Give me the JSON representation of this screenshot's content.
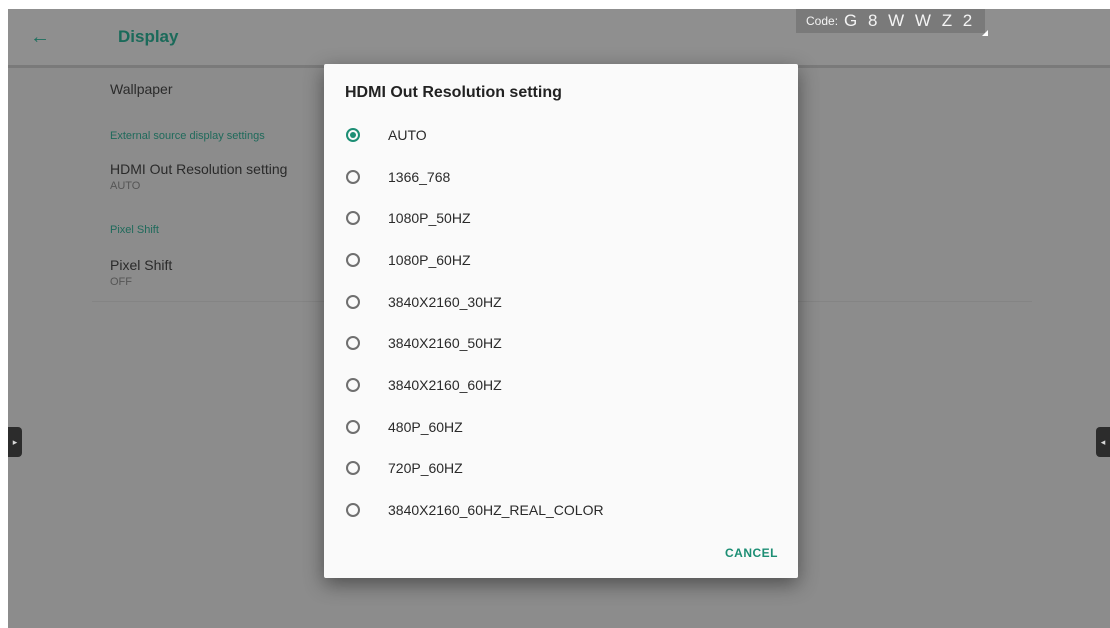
{
  "toolbar": {
    "title": "Display",
    "back_icon": "arrow-left-icon"
  },
  "code": {
    "label": "Code:",
    "value": "G 8 W W Z 2"
  },
  "settings": {
    "wallpaper": {
      "title": "Wallpaper"
    },
    "external_header": "External source display settings",
    "hdmi": {
      "title": "HDMI Out Resolution setting",
      "summary": "AUTO"
    },
    "pixel_shift_header": "Pixel Shift",
    "pixel_shift": {
      "title": "Pixel Shift",
      "summary": "OFF"
    }
  },
  "side_tabs": {
    "left": "▸",
    "right": "◂"
  },
  "dialog": {
    "title": "HDMI Out Resolution setting",
    "selected": "AUTO",
    "options": [
      "AUTO",
      "1366_768",
      "1080P_50HZ",
      "1080P_60HZ",
      "3840X2160_30HZ",
      "3840X2160_50HZ",
      "3840X2160_60HZ",
      "480P_60HZ",
      "720P_60HZ",
      "3840X2160_60HZ_REAL_COLOR"
    ],
    "cancel_label": "CANCEL"
  },
  "colors": {
    "accent": "#1c8e74",
    "scrim": "#8c8c8c"
  }
}
